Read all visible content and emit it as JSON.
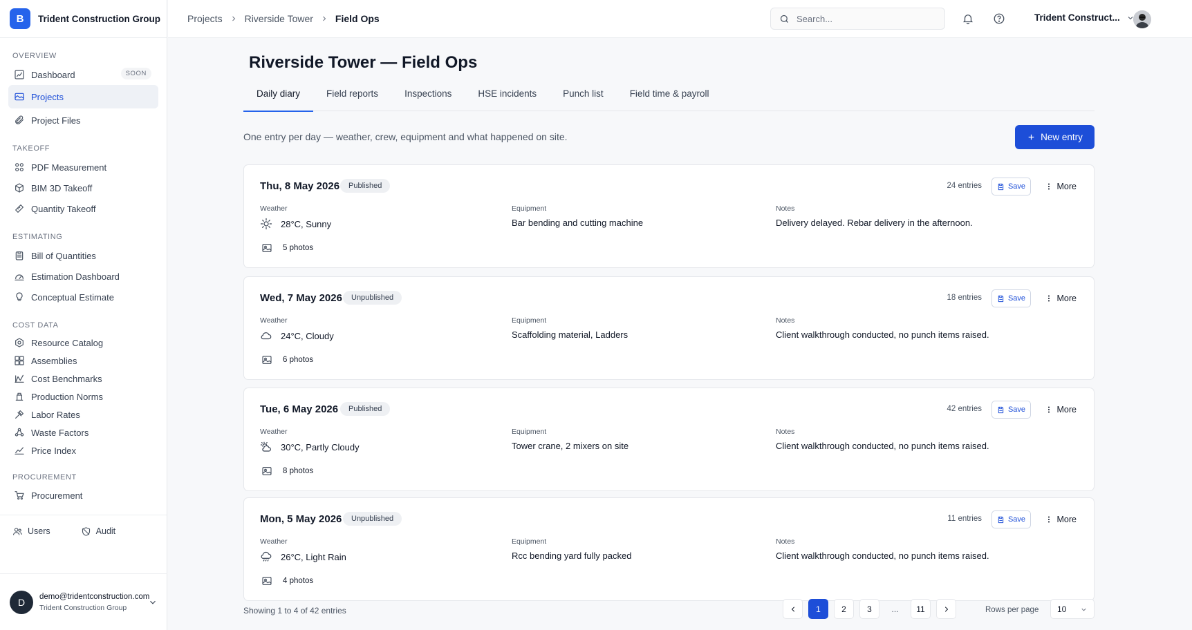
{
  "brand": {
    "logo_letter": "B",
    "name": "Trident Construction Group"
  },
  "sidebar": {
    "sections": [
      {
        "title": "OVERVIEW",
        "items": [
          {
            "label": "Dashboard",
            "icon": "dashboard-icon",
            "badge": "SOON"
          },
          {
            "label": "Projects",
            "icon": "projects-icon",
            "active": true
          },
          {
            "label": "Project Files",
            "icon": "paperclip-icon"
          }
        ]
      },
      {
        "title": "TAKEOFF",
        "items": [
          {
            "label": "PDF Measurement",
            "icon": "grid-icon"
          },
          {
            "label": "BIM 3D Takeoff",
            "icon": "cube-icon"
          },
          {
            "label": "Quantity Takeoff",
            "icon": "ruler-icon"
          }
        ]
      },
      {
        "title": "ESTIMATING",
        "items": [
          {
            "label": "Bill of Quantities",
            "icon": "clipboard-icon"
          },
          {
            "label": "Estimation Dashboard",
            "icon": "gauge-icon"
          },
          {
            "label": "Conceptual Estimate",
            "icon": "lightbulb-icon"
          }
        ]
      },
      {
        "title": "COST DATA",
        "items": [
          {
            "label": "Resource Catalog",
            "icon": "hexagon-icon"
          },
          {
            "label": "Assemblies",
            "icon": "blocks-icon"
          },
          {
            "label": "Cost Benchmarks",
            "icon": "benchmark-icon"
          },
          {
            "label": "Production Norms",
            "icon": "worker-icon"
          },
          {
            "label": "Labor Rates",
            "icon": "labor-icon"
          },
          {
            "label": "Waste Factors",
            "icon": "recycle-icon"
          },
          {
            "label": "Price Index",
            "icon": "trend-icon"
          }
        ]
      },
      {
        "title": "PROCUREMENT",
        "items": [
          {
            "label": "Procurement",
            "icon": "cart-icon"
          }
        ]
      }
    ],
    "tools": {
      "users": "Users",
      "audit": "Audit"
    },
    "account": {
      "initial": "D",
      "email": "demo@tridentconstruction.com",
      "org": "Trident Construction Group"
    }
  },
  "topbar": {
    "breadcrumb": [
      "Projects",
      "Riverside Tower",
      "Field Ops"
    ],
    "search_placeholder": "Search...",
    "org_switch": "Trident Construct..."
  },
  "main": {
    "title": "Riverside Tower — Field Ops",
    "tabs": [
      "Daily diary",
      "Field reports",
      "Inspections",
      "HSE incidents",
      "Punch list",
      "Field time & payroll"
    ],
    "active_tab": "Daily diary",
    "subtitle": "One entry per day — weather, crew, equipment and what happened on site.",
    "new_entry_label": "New entry",
    "field_labels": {
      "weather": "Weather",
      "equipment": "Equipment",
      "notes": "Notes"
    },
    "save_label": "Save",
    "more_label": "More"
  },
  "entries": [
    {
      "date": "Thu, 8 May 2026",
      "status": "Published",
      "entries": "24 entries",
      "weather": "28°C, Sunny",
      "weather_icon": "sun-icon",
      "equipment": "Bar bending and cutting machine",
      "notes": "Delivery delayed. Rebar delivery in the afternoon.",
      "photos": "5 photos"
    },
    {
      "date": "Wed, 7 May 2026",
      "status": "Unpublished",
      "entries": "18 entries",
      "weather": "24°C, Cloudy",
      "weather_icon": "cloud-icon",
      "equipment": "Scaffolding material, Ladders",
      "notes": "Client walkthrough conducted, no punch items raised.",
      "photos": "6 photos"
    },
    {
      "date": "Tue, 6 May 2026",
      "status": "Published",
      "entries": "42 entries",
      "weather": "30°C, Partly Cloudy",
      "weather_icon": "partly-cloudy-icon",
      "equipment": "Tower crane, 2 mixers on site",
      "notes": "Client walkthrough conducted, no punch items raised.",
      "photos": "8 photos"
    },
    {
      "date": "Mon, 5 May 2026",
      "status": "Unpublished",
      "entries": "11 entries",
      "weather": "26°C, Light Rain",
      "weather_icon": "rain-icon",
      "equipment": "Rcc bending yard fully packed",
      "notes": "Client walkthrough conducted, no punch items raised.",
      "photos": "4 photos"
    }
  ],
  "pagination": {
    "showing": "Showing 1 to 4 of 42 entries",
    "pages": [
      "1",
      "2",
      "3",
      "...",
      "11"
    ],
    "current_page": "1",
    "rows_label": "Rows per page",
    "rows_value": "10"
  },
  "colors": {
    "accent": "#1d4ed8",
    "brand": "#2563eb",
    "background": "#f7f8fa"
  }
}
